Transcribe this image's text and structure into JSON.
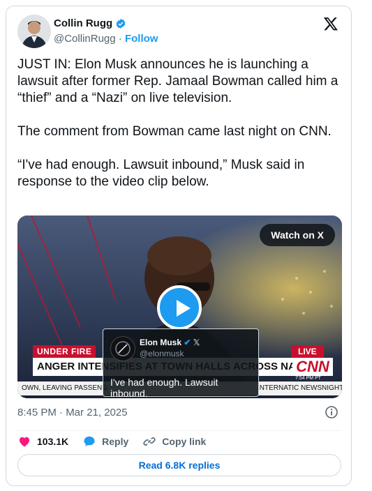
{
  "author": {
    "name": "Collin Rugg",
    "handle": "@CollinRugg",
    "separator": "·",
    "follow_label": "Follow"
  },
  "tweet": {
    "text": "JUST IN: Elon Musk announces he is launching a lawsuit after former Rep. Jamaal Bowman called him a “thief” and a “Nazi” on live television.\n\nThe comment from Bowman came last night on CNN.\n\n“I've had enough. Lawsuit inbound,” Musk said in response to the video clip below.",
    "timestamp": "8:45 PM · Mar 21, 2025"
  },
  "media": {
    "watch_label": "Watch on X",
    "under_fire": "UNDER FIRE",
    "live": "LIVE",
    "headline": "ANGER INTENSIFIES AT TOWN HALLS ACROSS NATION OVER CUTS",
    "network": "CNN",
    "time": "7:54 PM PT",
    "ticker": "OWN, LEAVING PASSENG",
    "ticker_right": "INTERNATIC NEWSNIGHT",
    "quote": {
      "name": "Elon Musk",
      "handle": "@elonmusk",
      "text": "I've had enough. Lawsuit inbound."
    }
  },
  "actions": {
    "likes": "103.1K",
    "reply": "Reply",
    "copy": "Copy link"
  },
  "read_replies": "Read 6.8K replies",
  "colors": {
    "accent": "#1d9bf0",
    "like": "#f91880",
    "cnn_red": "#c8102e"
  }
}
